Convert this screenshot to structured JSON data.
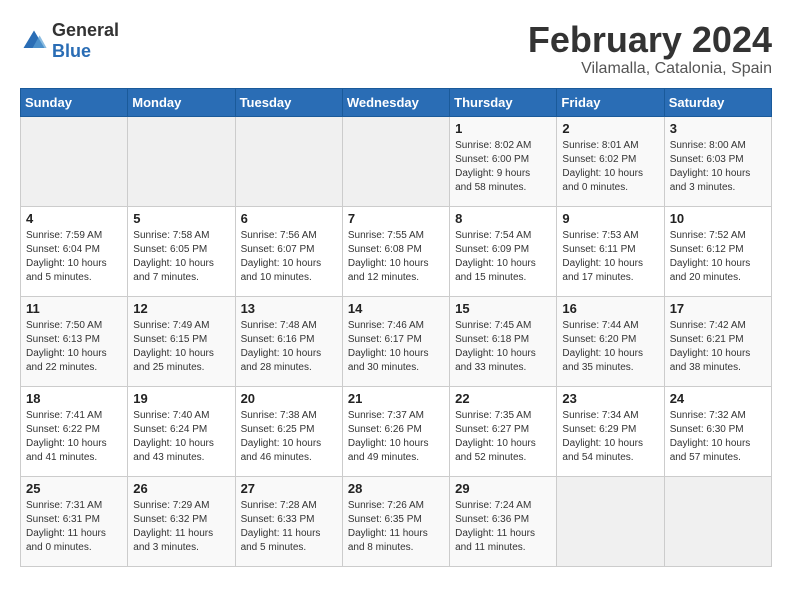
{
  "logo": {
    "general": "General",
    "blue": "Blue"
  },
  "title": "February 2024",
  "location": "Vilamalla, Catalonia, Spain",
  "days_header": [
    "Sunday",
    "Monday",
    "Tuesday",
    "Wednesday",
    "Thursday",
    "Friday",
    "Saturday"
  ],
  "weeks": [
    [
      {
        "day": "",
        "info": ""
      },
      {
        "day": "",
        "info": ""
      },
      {
        "day": "",
        "info": ""
      },
      {
        "day": "",
        "info": ""
      },
      {
        "day": "1",
        "info": "Sunrise: 8:02 AM\nSunset: 6:00 PM\nDaylight: 9 hours\nand 58 minutes."
      },
      {
        "day": "2",
        "info": "Sunrise: 8:01 AM\nSunset: 6:02 PM\nDaylight: 10 hours\nand 0 minutes."
      },
      {
        "day": "3",
        "info": "Sunrise: 8:00 AM\nSunset: 6:03 PM\nDaylight: 10 hours\nand 3 minutes."
      }
    ],
    [
      {
        "day": "4",
        "info": "Sunrise: 7:59 AM\nSunset: 6:04 PM\nDaylight: 10 hours\nand 5 minutes."
      },
      {
        "day": "5",
        "info": "Sunrise: 7:58 AM\nSunset: 6:05 PM\nDaylight: 10 hours\nand 7 minutes."
      },
      {
        "day": "6",
        "info": "Sunrise: 7:56 AM\nSunset: 6:07 PM\nDaylight: 10 hours\nand 10 minutes."
      },
      {
        "day": "7",
        "info": "Sunrise: 7:55 AM\nSunset: 6:08 PM\nDaylight: 10 hours\nand 12 minutes."
      },
      {
        "day": "8",
        "info": "Sunrise: 7:54 AM\nSunset: 6:09 PM\nDaylight: 10 hours\nand 15 minutes."
      },
      {
        "day": "9",
        "info": "Sunrise: 7:53 AM\nSunset: 6:11 PM\nDaylight: 10 hours\nand 17 minutes."
      },
      {
        "day": "10",
        "info": "Sunrise: 7:52 AM\nSunset: 6:12 PM\nDaylight: 10 hours\nand 20 minutes."
      }
    ],
    [
      {
        "day": "11",
        "info": "Sunrise: 7:50 AM\nSunset: 6:13 PM\nDaylight: 10 hours\nand 22 minutes."
      },
      {
        "day": "12",
        "info": "Sunrise: 7:49 AM\nSunset: 6:15 PM\nDaylight: 10 hours\nand 25 minutes."
      },
      {
        "day": "13",
        "info": "Sunrise: 7:48 AM\nSunset: 6:16 PM\nDaylight: 10 hours\nand 28 minutes."
      },
      {
        "day": "14",
        "info": "Sunrise: 7:46 AM\nSunset: 6:17 PM\nDaylight: 10 hours\nand 30 minutes."
      },
      {
        "day": "15",
        "info": "Sunrise: 7:45 AM\nSunset: 6:18 PM\nDaylight: 10 hours\nand 33 minutes."
      },
      {
        "day": "16",
        "info": "Sunrise: 7:44 AM\nSunset: 6:20 PM\nDaylight: 10 hours\nand 35 minutes."
      },
      {
        "day": "17",
        "info": "Sunrise: 7:42 AM\nSunset: 6:21 PM\nDaylight: 10 hours\nand 38 minutes."
      }
    ],
    [
      {
        "day": "18",
        "info": "Sunrise: 7:41 AM\nSunset: 6:22 PM\nDaylight: 10 hours\nand 41 minutes."
      },
      {
        "day": "19",
        "info": "Sunrise: 7:40 AM\nSunset: 6:24 PM\nDaylight: 10 hours\nand 43 minutes."
      },
      {
        "day": "20",
        "info": "Sunrise: 7:38 AM\nSunset: 6:25 PM\nDaylight: 10 hours\nand 46 minutes."
      },
      {
        "day": "21",
        "info": "Sunrise: 7:37 AM\nSunset: 6:26 PM\nDaylight: 10 hours\nand 49 minutes."
      },
      {
        "day": "22",
        "info": "Sunrise: 7:35 AM\nSunset: 6:27 PM\nDaylight: 10 hours\nand 52 minutes."
      },
      {
        "day": "23",
        "info": "Sunrise: 7:34 AM\nSunset: 6:29 PM\nDaylight: 10 hours\nand 54 minutes."
      },
      {
        "day": "24",
        "info": "Sunrise: 7:32 AM\nSunset: 6:30 PM\nDaylight: 10 hours\nand 57 minutes."
      }
    ],
    [
      {
        "day": "25",
        "info": "Sunrise: 7:31 AM\nSunset: 6:31 PM\nDaylight: 11 hours\nand 0 minutes."
      },
      {
        "day": "26",
        "info": "Sunrise: 7:29 AM\nSunset: 6:32 PM\nDaylight: 11 hours\nand 3 minutes."
      },
      {
        "day": "27",
        "info": "Sunrise: 7:28 AM\nSunset: 6:33 PM\nDaylight: 11 hours\nand 5 minutes."
      },
      {
        "day": "28",
        "info": "Sunrise: 7:26 AM\nSunset: 6:35 PM\nDaylight: 11 hours\nand 8 minutes."
      },
      {
        "day": "29",
        "info": "Sunrise: 7:24 AM\nSunset: 6:36 PM\nDaylight: 11 hours\nand 11 minutes."
      },
      {
        "day": "",
        "info": ""
      },
      {
        "day": "",
        "info": ""
      }
    ]
  ]
}
